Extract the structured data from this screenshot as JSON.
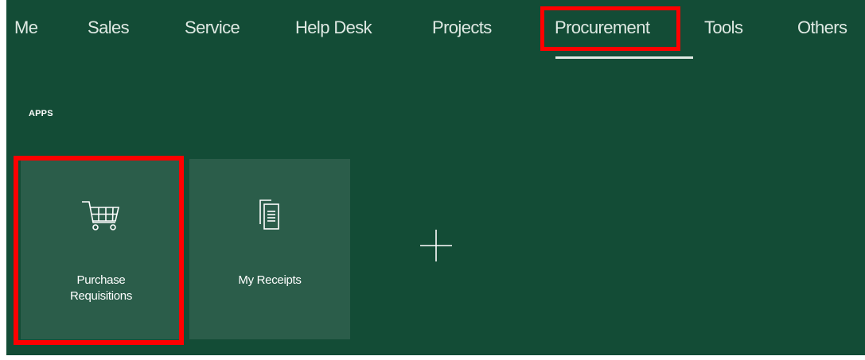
{
  "nav": {
    "items": [
      {
        "id": "me",
        "label": "Me"
      },
      {
        "id": "sales",
        "label": "Sales"
      },
      {
        "id": "service",
        "label": "Service"
      },
      {
        "id": "help-desk",
        "label": "Help Desk"
      },
      {
        "id": "projects",
        "label": "Projects"
      },
      {
        "id": "procurement",
        "label": "Procurement"
      },
      {
        "id": "tools",
        "label": "Tools"
      },
      {
        "id": "others",
        "label": "Others"
      }
    ],
    "active": "Procurement"
  },
  "apps": {
    "section_label": "APPS",
    "tiles": [
      {
        "label_line1": "Purchase",
        "label_line2": "Requisitions",
        "icon": "shopping-cart-icon"
      },
      {
        "label": "My Receipts",
        "icon": "documents-icon"
      }
    ],
    "add_icon": "plus-icon"
  },
  "colors": {
    "background": "#134c36",
    "tile": "#2b5d4a",
    "highlight": "#ff0000",
    "text": "#ffffff"
  }
}
